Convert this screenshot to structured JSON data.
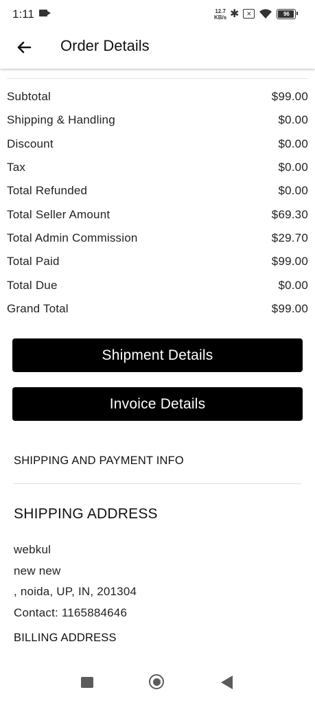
{
  "status_bar": {
    "time": "1:11",
    "speed_value": "12.7",
    "speed_unit": "KB/s",
    "battery_level": "96",
    "icons": [
      "camera-icon",
      "bluetooth-icon",
      "sim-x-icon",
      "wifi-icon",
      "battery-icon"
    ]
  },
  "app_bar": {
    "title": "Order Details",
    "back_icon": "arrow-left-icon"
  },
  "totals": [
    {
      "label": "Subtotal",
      "value": "$99.00"
    },
    {
      "label": "Shipping & Handling",
      "value": "$0.00"
    },
    {
      "label": "Discount",
      "value": "$0.00"
    },
    {
      "label": "Tax",
      "value": "$0.00"
    },
    {
      "label": "Total Refunded",
      "value": "$0.00"
    },
    {
      "label": "Total Seller Amount",
      "value": "$69.30"
    },
    {
      "label": "Total Admin Commission",
      "value": "$29.70"
    },
    {
      "label": "Total Paid",
      "value": "$99.00"
    },
    {
      "label": "Total Due",
      "value": "$0.00"
    },
    {
      "label": "Grand Total",
      "value": "$99.00"
    }
  ],
  "buttons": {
    "shipment": "Shipment Details",
    "invoice": "Invoice Details"
  },
  "info_section": {
    "title": "SHIPPING AND PAYMENT INFO",
    "shipping_heading": "SHIPPING ADDRESS",
    "address_lines": [
      "webkul",
      "new new",
      ", noida, UP, IN, 201304",
      "Contact: 1165884646"
    ],
    "billing_heading": "BILLING ADDRESS"
  },
  "colors": {
    "button_bg": "#000000",
    "button_text": "#ffffff",
    "text": "#222222"
  }
}
